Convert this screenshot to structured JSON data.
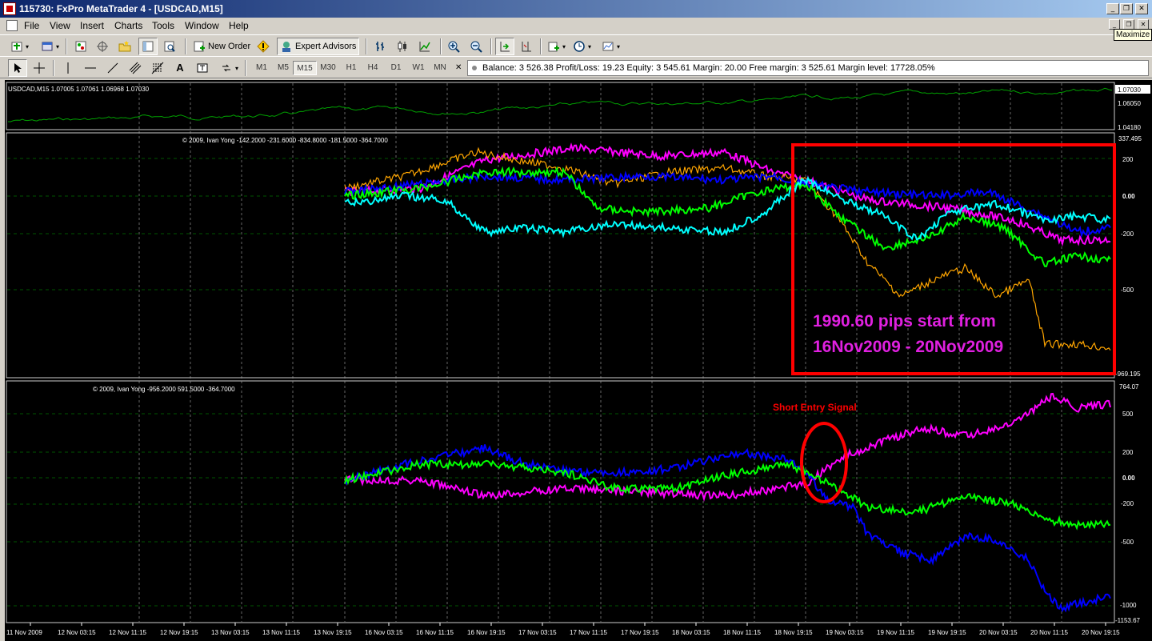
{
  "window": {
    "title": "115730: FxPro MetaTrader 4 - [USDCAD,M15]"
  },
  "menu": [
    "File",
    "View",
    "Insert",
    "Charts",
    "Tools",
    "Window",
    "Help"
  ],
  "tooltip": "Maximize",
  "toolbar": {
    "new_order": "New Order",
    "expert_advisors": "Expert Advisors"
  },
  "timeframes": [
    "M1",
    "M5",
    "M15",
    "M30",
    "H1",
    "H4",
    "D1",
    "W1",
    "MN"
  ],
  "active_timeframe": "M15",
  "account": {
    "text": "Balance: 3 526.38  Profit/Loss: 19.23  Equity: 3 545.61  Margin: 20.00  Free margin: 3 525.61  Margin level: 17728.05%"
  },
  "main_chart": {
    "header": "USDCAD,M15  1.07005 1.07061 1.06968 1.07030",
    "price_labels": [
      "1.07030",
      "1.06050",
      "1.04180"
    ],
    "line_color": "#00a000"
  },
  "indicator1": {
    "header": "© 2009, Ivan Yong -142.2000 -231.6000 -834.8000 -181.5000 -364.7000",
    "scale_labels": [
      "337.495",
      "200",
      "0.00",
      "-200",
      "-500",
      "-969.195"
    ],
    "series_colors": [
      "#ff00ff",
      "#ffa500",
      "#0000ff",
      "#00ff00",
      "#00ffff"
    ]
  },
  "indicator2": {
    "header": "© 2009, Ivan Yong -956.2000 591.5000 -364.7000",
    "scale_labels": [
      "764.07",
      "500",
      "200",
      "0.00",
      "-200",
      "-500",
      "-1000",
      "-1153.67"
    ],
    "series_colors": [
      "#ff00ff",
      "#00ff00",
      "#0000ff"
    ]
  },
  "annotations": {
    "pips_text_line1": "1990.60 pips start from",
    "pips_text_line2": "16Nov2009 - 20Nov2009",
    "signal_text": "Short Entry Signal",
    "text_color": "#e020e0",
    "box_color": "#ff0000"
  },
  "time_axis": [
    "11 Nov 2009",
    "12 Nov 03:15",
    "12 Nov 11:15",
    "12 Nov 19:15",
    "13 Nov 03:15",
    "13 Nov 11:15",
    "13 Nov 19:15",
    "16 Nov 03:15",
    "16 Nov 11:15",
    "16 Nov 19:15",
    "17 Nov 03:15",
    "17 Nov 11:15",
    "17 Nov 19:15",
    "18 Nov 03:15",
    "18 Nov 11:15",
    "18 Nov 19:15",
    "19 Nov 03:15",
    "19 Nov 11:15",
    "19 Nov 19:15",
    "20 Nov 03:15",
    "20 Nov 11:15",
    "20 Nov 19:15"
  ]
}
